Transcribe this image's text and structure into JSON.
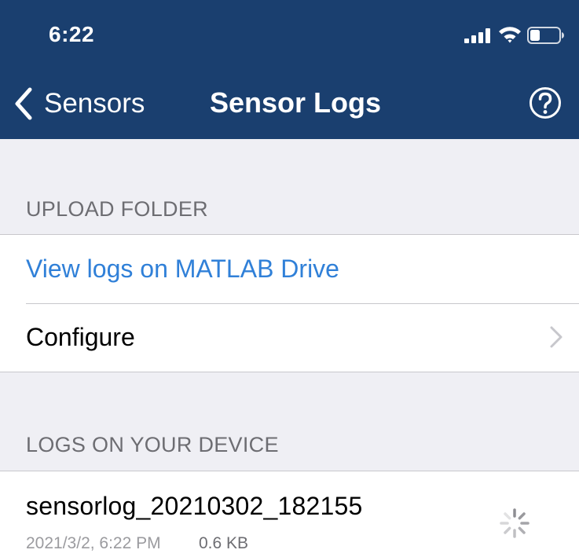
{
  "status_bar": {
    "time": "6:22"
  },
  "nav": {
    "back_label": "Sensors",
    "title": "Sensor Logs"
  },
  "upload_folder": {
    "header": "UPLOAD FOLDER",
    "view_logs_label": "View logs on MATLAB Drive",
    "configure_label": "Configure"
  },
  "device_logs": {
    "header": "LOGS ON YOUR DEVICE",
    "items": [
      {
        "name": "sensorlog_20210302_182155",
        "date": "2021/3/2, 6:22 PM",
        "size": "0.6 KB"
      }
    ]
  },
  "colors": {
    "nav_bar": "#1a3f6f",
    "link": "#3080d8",
    "background": "#efeff4"
  },
  "icons": [
    "signal-icon",
    "wifi-icon",
    "battery-icon",
    "back-chevron-icon",
    "help-icon",
    "chevron-right-icon",
    "loading-spinner-icon"
  ]
}
